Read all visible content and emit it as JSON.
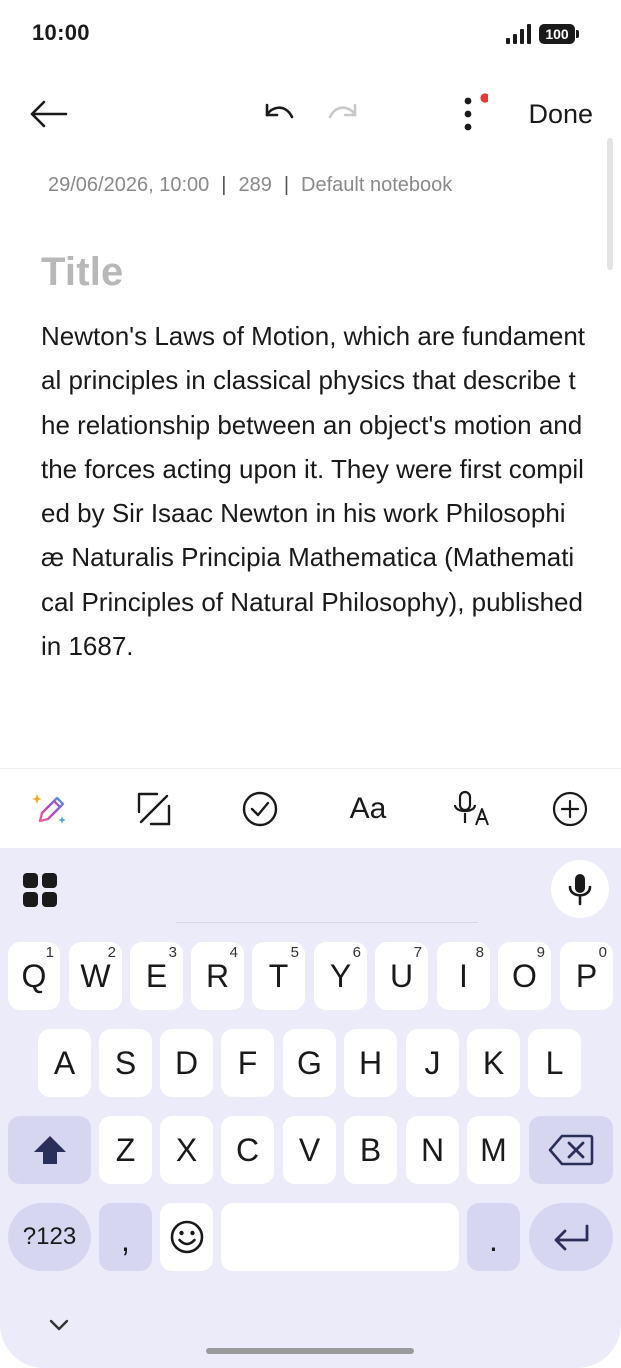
{
  "status_bar": {
    "time": "10:00",
    "battery": "100",
    "signal_icon": "signal-icon"
  },
  "toolbar": {
    "back_icon": "arrow-left-icon",
    "undo_icon": "undo-icon",
    "redo_icon": "redo-icon",
    "more_icon": "more-vertical-icon",
    "done_label": "Done",
    "notification_color": "#e53935"
  },
  "note": {
    "date": "29/06/2026, 10:00",
    "separator": "|",
    "char_count": "289",
    "notebook": "Default notebook",
    "title_placeholder": "Title",
    "body": "Newton's Laws of Motion, which are fundamental principles in classical physics that describe the relationship between an object's motion and the forces acting upon it. They were first compiled by Sir Isaac Newton in his work Philosophiæ Naturalis Principia Mathematica (Mathematical Principles of Natural Philosophy), published in 1687."
  },
  "format_bar": {
    "ai_icon": "ai-pen-sparkle-icon",
    "handwriting_icon": "handwriting-icon",
    "checklist_icon": "checklist-icon",
    "text_style_label": "Aa",
    "voice_icon": "voice-to-text-icon",
    "add_icon": "add-circle-icon"
  },
  "keyboard": {
    "apps_icon": "apps-grid-icon",
    "mic_icon": "microphone-icon",
    "row1": [
      {
        "key": "Q",
        "hint": "1"
      },
      {
        "key": "W",
        "hint": "2"
      },
      {
        "key": "E",
        "hint": "3"
      },
      {
        "key": "R",
        "hint": "4"
      },
      {
        "key": "T",
        "hint": "5"
      },
      {
        "key": "Y",
        "hint": "6"
      },
      {
        "key": "U",
        "hint": "7"
      },
      {
        "key": "I",
        "hint": "8"
      },
      {
        "key": "O",
        "hint": "9"
      },
      {
        "key": "P",
        "hint": "0"
      }
    ],
    "row2": [
      "A",
      "S",
      "D",
      "F",
      "G",
      "H",
      "J",
      "K",
      "L"
    ],
    "row3": [
      "Z",
      "X",
      "C",
      "V",
      "B",
      "N",
      "M"
    ],
    "shift_icon": "shift-icon",
    "backspace_icon": "backspace-icon",
    "symbols_label": "?123",
    "comma_label": ",",
    "emoji_icon": "emoji-icon",
    "period_label": ".",
    "enter_icon": "enter-icon",
    "collapse_icon": "chevron-down-icon",
    "accent_color": "#ecebf9",
    "special_key_color": "#d7d6f1"
  }
}
